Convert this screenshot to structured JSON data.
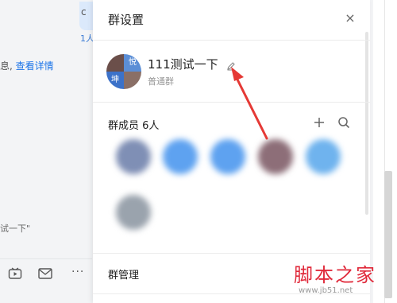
{
  "background_chat": {
    "bubble_glyph": "c",
    "read_count": "1人",
    "notice_prefix": "息,",
    "notice_link": "查看详情",
    "quoted_text": "试一下\"",
    "toolbar_icons": [
      "video-icon",
      "mail-icon",
      "more-icon"
    ],
    "more_glyph": "···"
  },
  "panel": {
    "title": "群设置",
    "close_glyph": "×",
    "group": {
      "name": "111测试一下",
      "type": "普通群",
      "avatar_quadrants": [
        "",
        "悦",
        "坤",
        ""
      ]
    },
    "members": {
      "label": "群成员 6人",
      "count": 6,
      "avatar_colors": [
        "#7f8fb5",
        "#5ea2f0",
        "#5ea2f0",
        "#8d6e78",
        "#6fb3ee",
        "#9aa3ad"
      ]
    },
    "manage_label": "群管理"
  },
  "annotation": {
    "color": "#e53935"
  },
  "watermark": {
    "main": "脚本之家",
    "sub": "www.jb51.net"
  }
}
